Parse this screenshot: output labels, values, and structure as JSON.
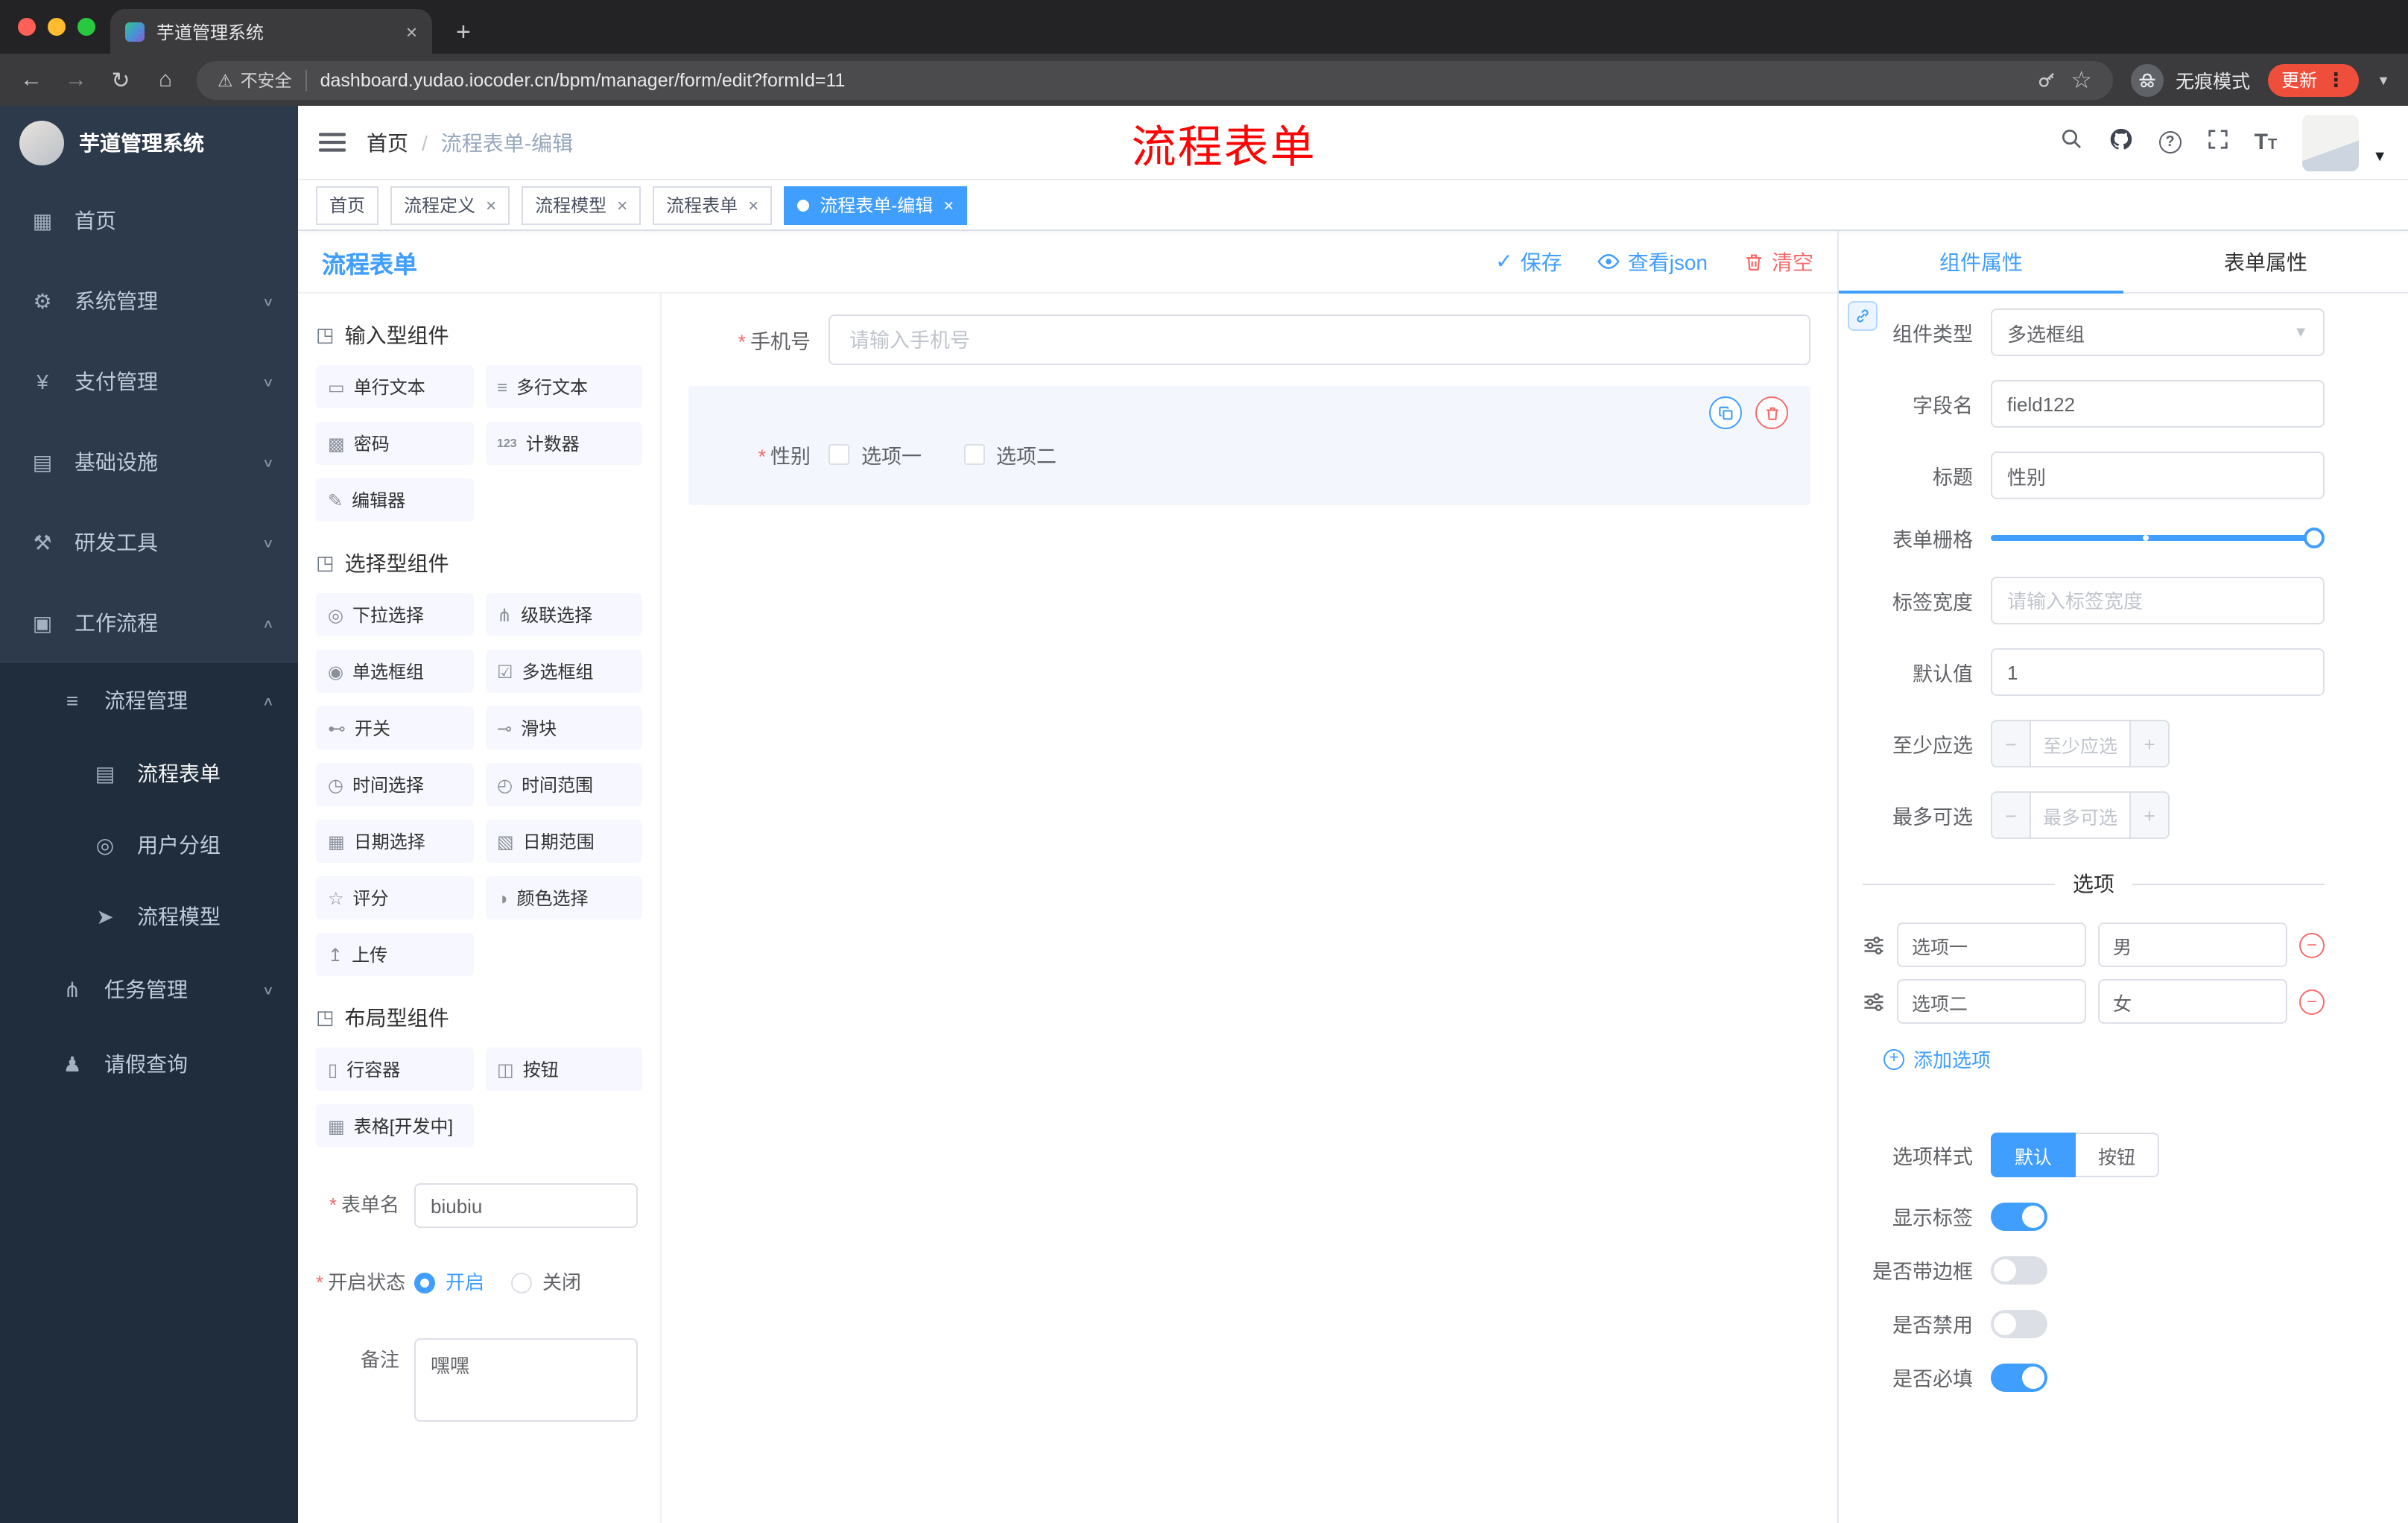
{
  "browser": {
    "tab_title": "芋道管理系统",
    "security_label": "不安全",
    "url": "dashboard.yudao.iocoder.cn/bpm/manager/form/edit?formId=11",
    "incognito_label": "无痕模式",
    "update_label": "更新"
  },
  "header": {
    "breadcrumb_home": "首页",
    "breadcrumb_sep": "/",
    "breadcrumb_current": "流程表单-编辑",
    "annotation": "流程表单"
  },
  "sidebar": {
    "title": "芋道管理系统",
    "home": "首页",
    "system": "系统管理",
    "payment": "支付管理",
    "infra": "基础设施",
    "devtools": "研发工具",
    "workflow": "工作流程",
    "process_mgmt": "流程管理",
    "process_form": "流程表单",
    "user_group": "用户分组",
    "process_model": "流程模型",
    "task_mgmt": "任务管理",
    "leave_query": "请假查询"
  },
  "tags": [
    {
      "label": "首页"
    },
    {
      "label": "流程定义"
    },
    {
      "label": "流程模型"
    },
    {
      "label": "流程表单"
    },
    {
      "label": "流程表单-编辑"
    }
  ],
  "designer": {
    "title": "流程表单",
    "save": "保存",
    "view_json": "查看json",
    "clear": "清空"
  },
  "palette": {
    "group_input": "输入型组件",
    "input_items": [
      "单行文本",
      "多行文本",
      "密码",
      "计数器",
      "编辑器"
    ],
    "group_select": "选择型组件",
    "select_items": [
      "下拉选择",
      "级联选择",
      "单选框组",
      "多选框组",
      "开关",
      "滑块",
      "时间选择",
      "时间范围",
      "日期选择",
      "日期范围",
      "评分",
      "颜色选择",
      "上传"
    ],
    "group_layout": "布局型组件",
    "layout_items": [
      "行容器",
      "按钮",
      "表格[开发中]"
    ]
  },
  "form_settings": {
    "name_label": "表单名",
    "name_value": "biubiu",
    "status_label": "开启状态",
    "status_on": "开启",
    "status_off": "关闭",
    "remark_label": "备注",
    "remark_value": "嘿嘿"
  },
  "canvas": {
    "phone_label": "手机号",
    "phone_placeholder": "请输入手机号",
    "gender_label": "性别",
    "gender_opt1": "选项一",
    "gender_opt2": "选项二"
  },
  "props": {
    "tab_component": "组件属性",
    "tab_form": "表单属性",
    "type_label": "组件类型",
    "type_value": "多选框组",
    "field_label": "字段名",
    "field_value": "field122",
    "title_label": "标题",
    "title_value": "性别",
    "grid_label": "表单栅格",
    "label_width_label": "标签宽度",
    "label_width_placeholder": "请输入标签宽度",
    "default_label": "默认值",
    "default_value": "1",
    "min_label": "至少应选",
    "min_placeholder": "至少应选",
    "max_label": "最多可选",
    "max_placeholder": "最多可选",
    "options_divider": "选项",
    "options": [
      {
        "name": "选项一",
        "value": "男"
      },
      {
        "name": "选项二",
        "value": "女"
      }
    ],
    "add_option": "添加选项",
    "style_label": "选项样式",
    "style_default": "默认",
    "style_button": "按钮",
    "show_label": "显示标签",
    "border_label": "是否带边框",
    "disabled_label": "是否禁用",
    "required_label": "是否必填",
    "accent_color": "#409eff",
    "danger_color": "#f56c6c"
  }
}
